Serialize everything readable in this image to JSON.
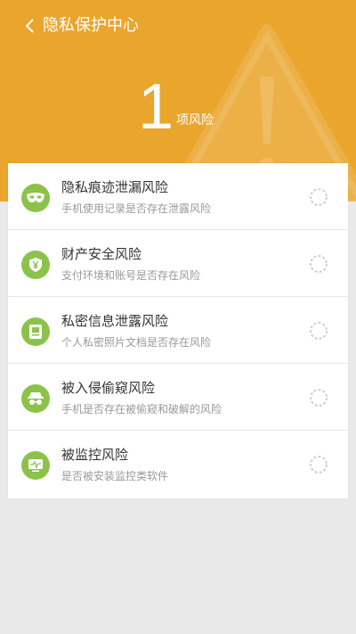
{
  "header": {
    "back_icon": "chevron-left-icon",
    "title": "隐私保护中心",
    "risk_count": "1",
    "risk_unit": "项风险",
    "background_color": "#eaa52d",
    "watermark_icon": "warning-triangle-icon"
  },
  "risk_items": [
    {
      "title": "隐私痕迹泄漏风险",
      "desc": "手机使用记录是否存在泄露风险",
      "icon": "mask-icon",
      "status_icon": "loading-spinner-icon"
    },
    {
      "title": "财产安全风险",
      "desc": "支付环境和账号是否存在风险",
      "icon": "shield-yen-icon",
      "status_icon": "loading-spinner-icon"
    },
    {
      "title": "私密信息泄露风险",
      "desc": "个人私密照片文档是否存在风险",
      "icon": "document-icon",
      "status_icon": "loading-spinner-icon"
    },
    {
      "title": "被入侵偷窥风险",
      "desc": "手机是否存在被偷窥和破解的风险",
      "icon": "spy-icon",
      "status_icon": "loading-spinner-icon"
    },
    {
      "title": "被监控风险",
      "desc": "是否被安装监控类软件",
      "icon": "monitor-icon",
      "status_icon": "loading-spinner-icon"
    }
  ],
  "colors": {
    "accent": "#eaa52d",
    "icon_green": "#8bc34a"
  }
}
